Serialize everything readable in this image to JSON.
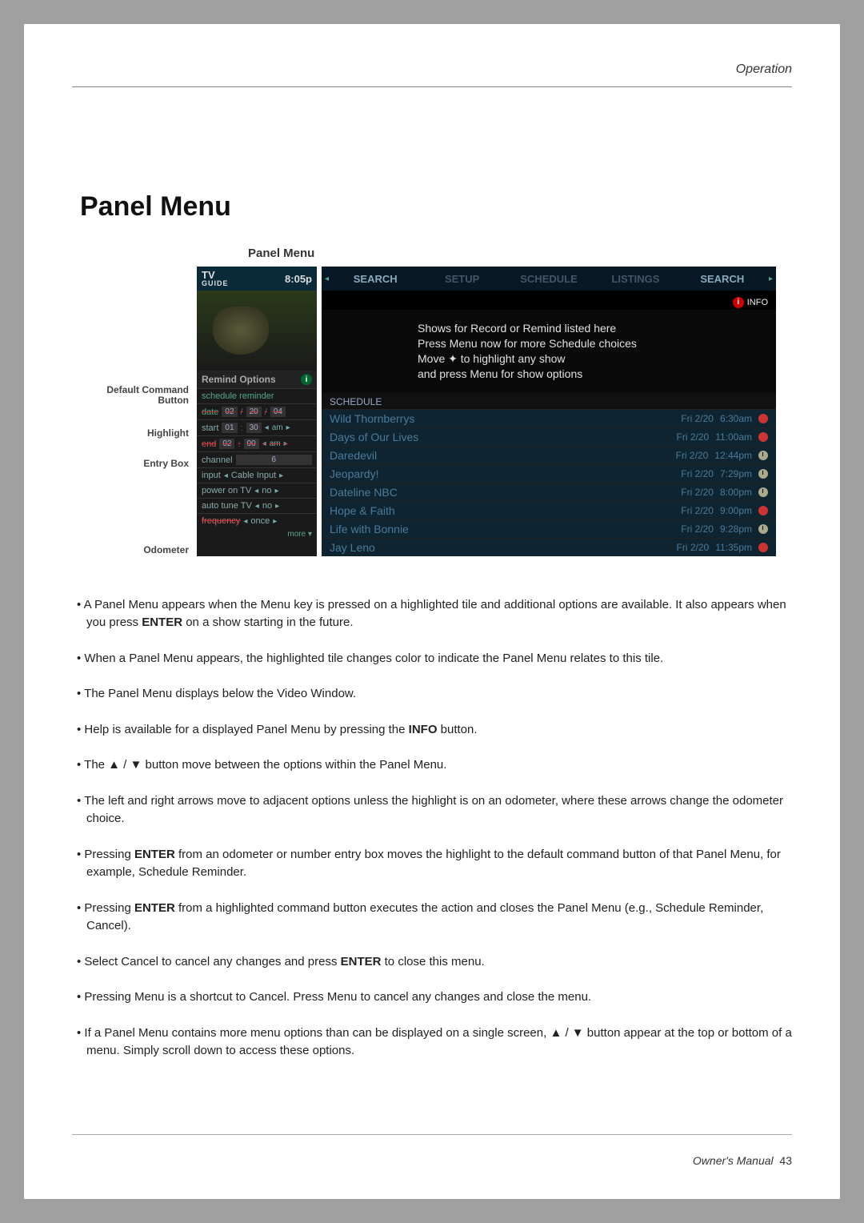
{
  "header": {
    "section": "Operation"
  },
  "title": "Panel Menu",
  "figure_caption": "Panel Menu",
  "callouts": {
    "default_command": "Default Command Button",
    "highlight": "Highlight",
    "entry_box": "Entry Box",
    "odometer": "Odometer"
  },
  "tvguide": {
    "logo_top": "TV",
    "logo_bottom": "GUIDE",
    "time": "8:05p"
  },
  "tabs": [
    "SEARCH",
    "SETUP",
    "SCHEDULE",
    "LISTINGS",
    "SEARCH"
  ],
  "info_label": "INFO",
  "message": "Shows for Record or Remind listed here\nPress Menu now for more Schedule choices\nMove ✦ to highlight any show\nand press Menu for show options",
  "remind_title": "Remind Options",
  "options": {
    "schedule_reminder": "schedule reminder",
    "date": {
      "label": "date",
      "m": "02",
      "d": "20",
      "y": "04"
    },
    "start": {
      "label": "start",
      "h": "01",
      "m": "30",
      "ampm": "am"
    },
    "end": {
      "label": "end",
      "h": "02",
      "m": "00",
      "ampm": "am"
    },
    "channel": {
      "label": "channel",
      "val": "6"
    },
    "input": {
      "label": "input",
      "val": "Cable Input"
    },
    "power": {
      "label": "power on TV",
      "val": "no"
    },
    "autotune": {
      "label": "auto tune TV",
      "val": "no"
    },
    "frequency": {
      "label": "frequency",
      "val": "once"
    },
    "more": "more ▾"
  },
  "schedule_label": "SCHEDULE",
  "rows": [
    {
      "show": "Wild Thornberrys",
      "date": "Fri 2/20",
      "time": "6:30am",
      "icon": "remind"
    },
    {
      "show": "Days of Our Lives",
      "date": "Fri 2/20",
      "time": "11:00am",
      "icon": "remind"
    },
    {
      "show": "Daredevil",
      "date": "Fri 2/20",
      "time": "12:44pm",
      "icon": "clock"
    },
    {
      "show": "Jeopardy!",
      "date": "Fri 2/20",
      "time": "7:29pm",
      "icon": "clock"
    },
    {
      "show": "Dateline NBC",
      "date": "Fri 2/20",
      "time": "8:00pm",
      "icon": "clock"
    },
    {
      "show": "Hope & Faith",
      "date": "Fri 2/20",
      "time": "9:00pm",
      "icon": "remind"
    },
    {
      "show": "Life with Bonnie",
      "date": "Fri 2/20",
      "time": "9:28pm",
      "icon": "clock"
    },
    {
      "show": "Jay Leno",
      "date": "Fri 2/20",
      "time": "11:35pm",
      "icon": "remind"
    }
  ],
  "bullets": [
    "A Panel Menu appears when the Menu key is pressed on a highlighted tile and additional options are available. It also appears when you press <b>ENTER</b> on a show starting in the future.",
    "When a Panel Menu appears, the highlighted tile changes color to indicate the Panel Menu relates to this tile.",
    "The Panel Menu displays below the Video Window.",
    "Help is available for a displayed Panel Menu by pressing the  <b>INFO</b> button.",
    "The ▲ / ▼ button move between the options within the Panel Menu.",
    "The left and right arrows move to adjacent options unless the highlight is on an odometer, where these arrows change the odometer choice.",
    "Pressing <b>ENTER</b> from an odometer or number entry box moves the highlight to the default command button of that Panel Menu, for example, Schedule Reminder.",
    "Pressing <b>ENTER</b> from a highlighted command button executes the action and closes the Panel Menu (e.g., Schedule Reminder, Cancel).",
    "Select Cancel to cancel any changes and press <b>ENTER</b> to close this menu.",
    "Pressing Menu is a shortcut to Cancel. Press Menu to cancel any changes and close the menu.",
    "If a Panel Menu contains more menu options than can be displayed on a single screen, ▲ / ▼ button appear at the top or bottom of a menu. Simply scroll down to access these options."
  ],
  "footer": {
    "book": "Owner's Manual",
    "page": "43"
  },
  "chart_data": {
    "type": "table",
    "title": "SCHEDULE",
    "columns": [
      "Show",
      "Date",
      "Time",
      "Icon"
    ],
    "rows": [
      [
        "Wild Thornberrys",
        "Fri 2/20",
        "6:30am",
        "remind"
      ],
      [
        "Days of Our Lives",
        "Fri 2/20",
        "11:00am",
        "remind"
      ],
      [
        "Daredevil",
        "Fri 2/20",
        "12:44pm",
        "clock"
      ],
      [
        "Jeopardy!",
        "Fri 2/20",
        "7:29pm",
        "clock"
      ],
      [
        "Dateline NBC",
        "Fri 2/20",
        "8:00pm",
        "clock"
      ],
      [
        "Hope & Faith",
        "Fri 2/20",
        "9:00pm",
        "remind"
      ],
      [
        "Life with Bonnie",
        "Fri 2/20",
        "9:28pm",
        "clock"
      ],
      [
        "Jay Leno",
        "Fri 2/20",
        "11:35pm",
        "remind"
      ]
    ]
  }
}
